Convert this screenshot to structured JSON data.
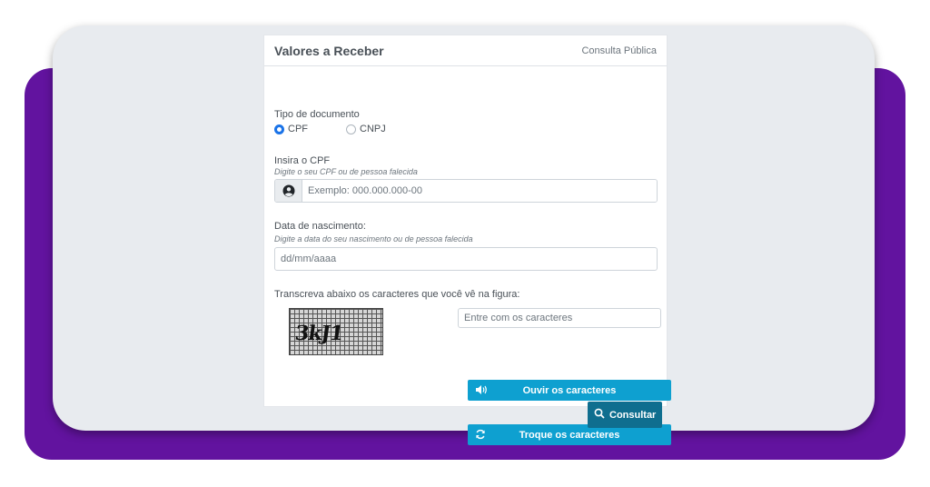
{
  "header": {
    "title": "Valores a Receber",
    "subtitle": "Consulta Pública"
  },
  "tipo_documento": {
    "label": "Tipo de documento",
    "options": [
      {
        "label": "CPF",
        "checked": true
      },
      {
        "label": "CNPJ",
        "checked": false
      }
    ]
  },
  "cpf": {
    "label": "Insira o CPF",
    "hint": "Digite o seu CPF ou de pessoa falecida",
    "placeholder": "Exemplo: 000.000.000-00",
    "icon": "user-circle-icon"
  },
  "nascimento": {
    "label": "Data de nascimento:",
    "hint": "Digite a data do seu nascimento ou de pessoa falecida",
    "placeholder": "dd/mm/aaaa"
  },
  "captcha": {
    "label": "Transcreva abaixo os caracteres que você vê na figura:",
    "image_text": "3kJ1",
    "input_placeholder": "Entre com os caracteres",
    "listen_label": "Ouvir os caracteres",
    "listen_icon": "volume-icon",
    "refresh_label": "Troque os caracteres",
    "refresh_icon": "refresh-icon"
  },
  "submit": {
    "label": "Consultar",
    "icon": "search-icon"
  },
  "colors": {
    "brand_purple": "#62139f",
    "button_blue": "#0ea0d0",
    "submit_teal": "#0f6e8f",
    "radio_blue": "#1a73e8"
  }
}
